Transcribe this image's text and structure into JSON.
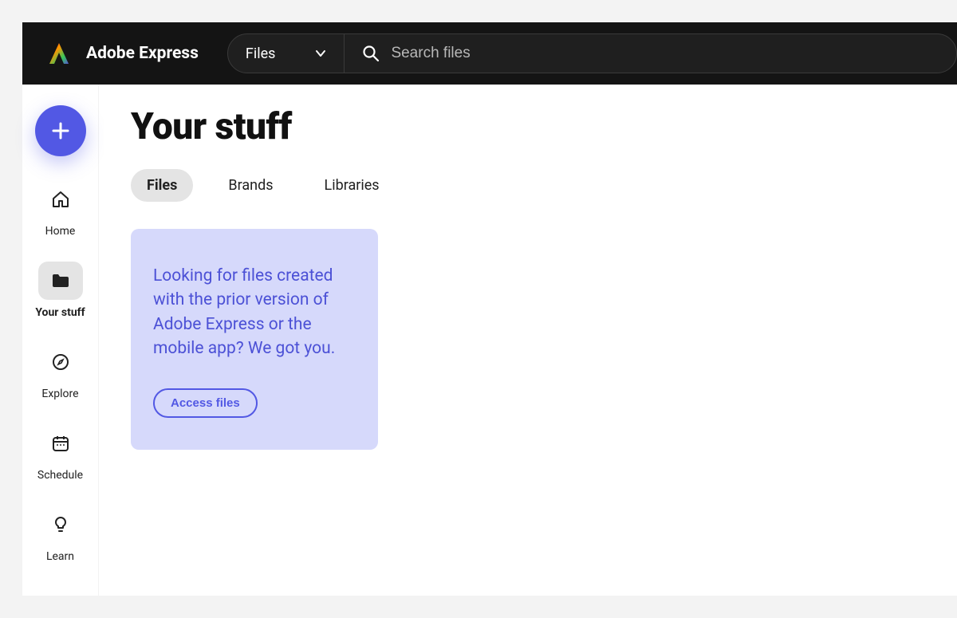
{
  "header": {
    "brand": "Adobe Express",
    "search_scope": "Files",
    "search_placeholder": "Search files"
  },
  "sidebar": {
    "items": [
      {
        "key": "home",
        "label": "Home"
      },
      {
        "key": "your-stuff",
        "label": "Your stuff"
      },
      {
        "key": "explore",
        "label": "Explore"
      },
      {
        "key": "schedule",
        "label": "Schedule"
      },
      {
        "key": "learn",
        "label": "Learn"
      }
    ]
  },
  "main": {
    "title": "Your stuff",
    "tabs": [
      {
        "key": "files",
        "label": "Files"
      },
      {
        "key": "brands",
        "label": "Brands"
      },
      {
        "key": "libraries",
        "label": "Libraries"
      }
    ],
    "info_card": {
      "message": "Looking for files created with the prior version of Adobe Express or the mobile app? We got you.",
      "cta": "Access files"
    }
  }
}
